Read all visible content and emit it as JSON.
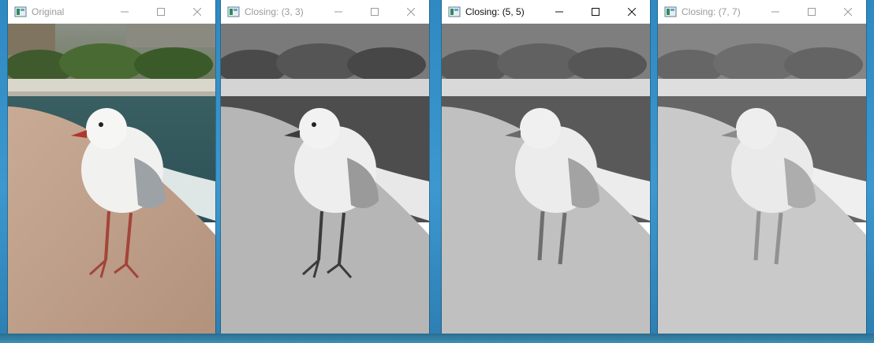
{
  "windows": [
    {
      "title": "Original",
      "mode": "color",
      "active": false
    },
    {
      "title": "Closing: (3, 3)",
      "mode": "gray",
      "active": false
    },
    {
      "title": "Closing: (5, 5)",
      "mode": "gray",
      "active": true
    },
    {
      "title": "Closing: (7, 7)",
      "mode": "gray",
      "active": false
    }
  ],
  "icons": {
    "app": "opencv-window-icon",
    "minimize": "minimize-icon",
    "maximize": "maximize-icon",
    "close": "close-icon"
  },
  "colors": {
    "inactive_title": "#9a9a9a",
    "active_title": "#111111",
    "desktop": "#2f89c2"
  }
}
